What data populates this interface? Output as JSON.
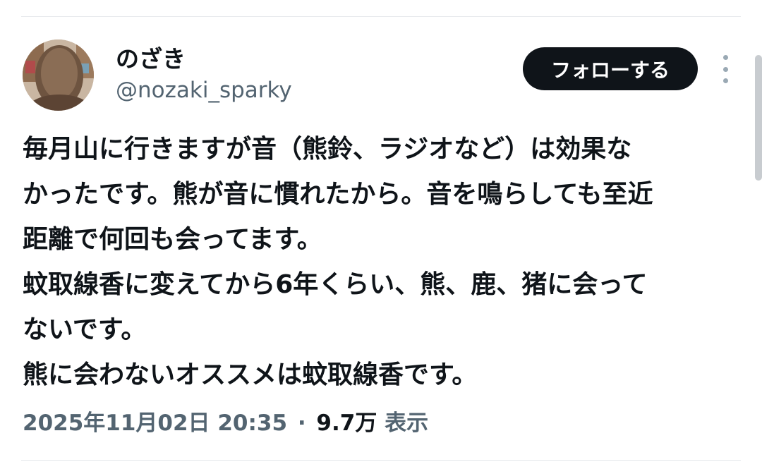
{
  "author": {
    "display_name": "のざき",
    "handle": "@nozaki_sparky"
  },
  "follow_button": {
    "label": "フォローする"
  },
  "tweet": {
    "lines": [
      "毎月山に行きますが音（熊鈴、ラジオなど）は効果な",
      "かったです。熊が音に慣れたから。音を鳴らしても至近",
      "距離で何回も会ってます。",
      "蚊取線香に変えてから6年くらい、熊、鹿、猪に会って",
      "ないです。",
      "熊に会わないオススメは蚊取線香です。"
    ]
  },
  "meta": {
    "timestamp": "2025年11月02日 20:35",
    "separator": "·",
    "views": "9.7万",
    "views_label": "表示"
  },
  "colors": {
    "text_primary": "#0f1419",
    "text_secondary": "#536471",
    "button_bg": "#0f1419",
    "button_text": "#ffffff",
    "divider": "#e6e9ec"
  },
  "icons": {
    "more": "more-vertical-icon"
  }
}
